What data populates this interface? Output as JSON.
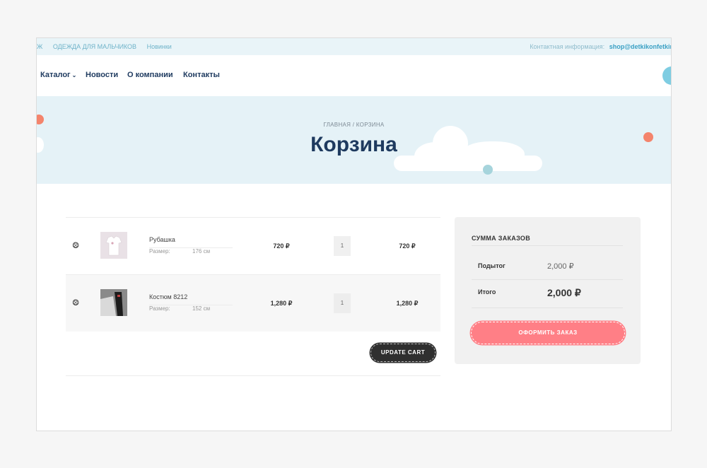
{
  "topbar": {
    "links": [
      "Ж",
      "ОДЕЖДА ДЛЯ МАЛЬЧИКОВ",
      "Новинки"
    ],
    "contact_label": "Контактная информация:",
    "contact_email": "shop@detkikonfetkin"
  },
  "nav": {
    "catalog": "Каталог",
    "news": "Новости",
    "about": "О компании",
    "contacts": "Контакты"
  },
  "hero": {
    "breadcrumb": "ГЛАВНАЯ / КОРЗИНА",
    "title": "Корзина"
  },
  "cart": {
    "size_label": "Размер:",
    "items": [
      {
        "name": "Рубашка",
        "size": "176 см",
        "price": "720 ₽",
        "quantity": "1",
        "subtotal": "720 ₽"
      },
      {
        "name": "Костюм 8212",
        "size": "152 см",
        "price": "1,280 ₽",
        "quantity": "1",
        "subtotal": "1,280 ₽"
      }
    ],
    "update_label": "UPDATE CART"
  },
  "summary": {
    "title": "СУММА ЗАКАЗОВ",
    "subtotal_label": "Подытог",
    "subtotal_value": "2,000 ₽",
    "total_label": "Итого",
    "total_value": "2,000 ₽",
    "checkout_label": "ОФОРМИТЬ ЗАКАЗ"
  },
  "colors": {
    "navy": "#1e3a5f",
    "accent_blue": "#3aa0c4",
    "checkout_pink": "#ff7f86",
    "dot_coral": "#f4846c",
    "dot_teal": "#a6d4dc"
  }
}
